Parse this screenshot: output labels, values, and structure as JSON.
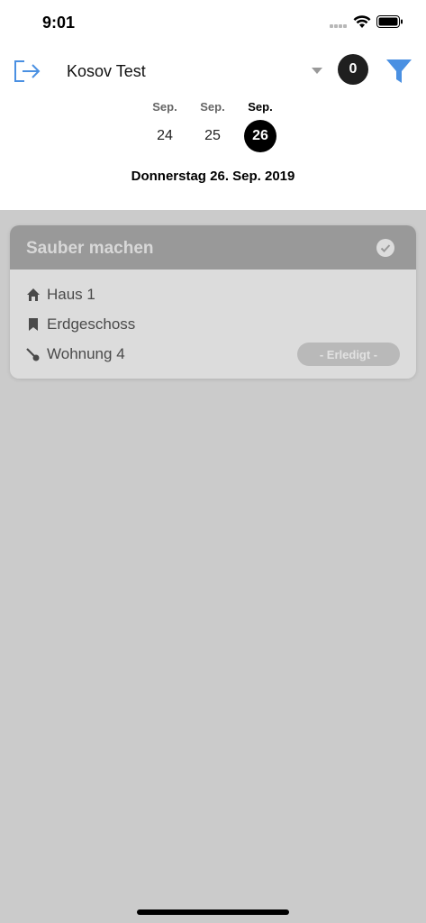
{
  "status_bar": {
    "time": "9:01"
  },
  "toolbar": {
    "account_name": "Kosov Test",
    "open_count": "0"
  },
  "date_strip": {
    "dates": [
      {
        "month": "Sep.",
        "day": "24"
      },
      {
        "month": "Sep.",
        "day": "25"
      },
      {
        "month": "Sep.",
        "day": "26"
      }
    ]
  },
  "full_date": "Donnerstag 26. Sep. 2019",
  "task": {
    "title": "Sauber machen",
    "building": "Haus 1",
    "floor": "Erdgeschoss",
    "unit": "Wohnung 4",
    "status": "- Erledigt -"
  },
  "colors": {
    "accent": "#4a90e2",
    "overlay": "#cbcbcb",
    "card_header": "#999999",
    "badge": "#1f1f1f"
  },
  "icons": {
    "logout": "logout-icon",
    "dropdown": "caret-down-icon",
    "filter": "filter-icon",
    "check": "check-circle-icon",
    "building": "house-icon",
    "floor": "bookmark-icon",
    "unit": "key-icon"
  }
}
